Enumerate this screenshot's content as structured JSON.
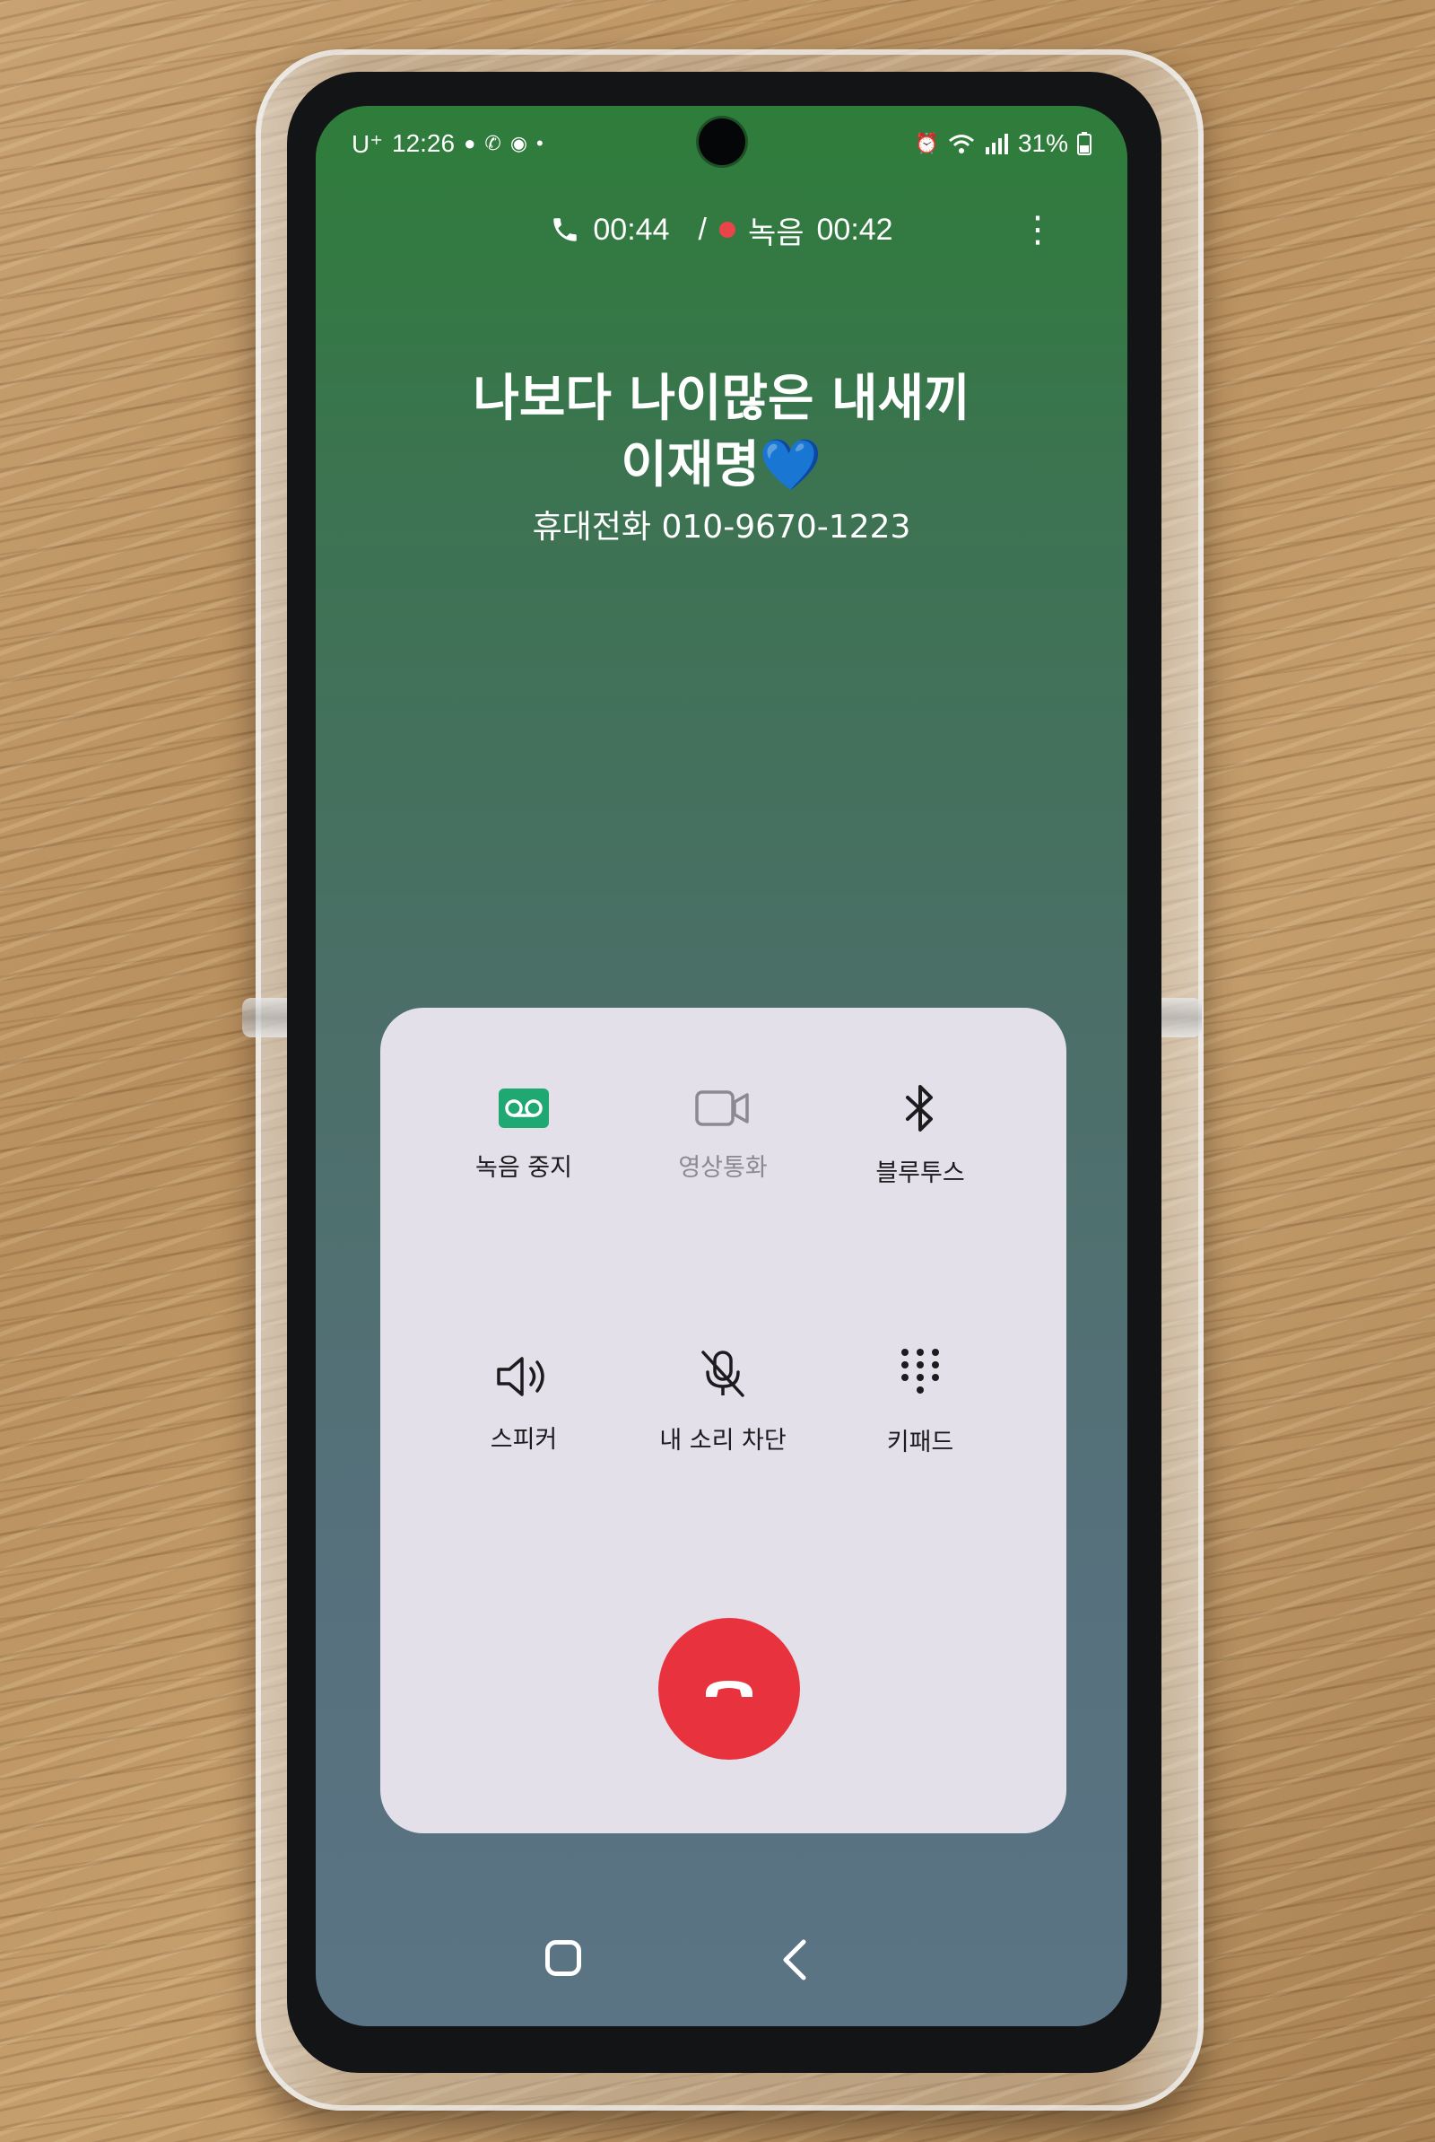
{
  "statusbar": {
    "carrier": "U⁺",
    "time": "12:26",
    "battery": "31%"
  },
  "call": {
    "duration": "00:44",
    "separator": "/",
    "recording_label": "녹음",
    "recording_time": "00:42",
    "more_icon": "⋮"
  },
  "contact": {
    "name_line1": "나보다 나이많은 내새끼",
    "name_line2": "이재명💙",
    "number": "휴대전화 010-9670-1223"
  },
  "controls": {
    "stop_recording": "녹음 중지",
    "video_call": "영상통화",
    "bluetooth": "블루투스",
    "speaker": "스피커",
    "mute": "내 소리 차단",
    "keypad": "키패드"
  },
  "colors": {
    "end_call": "#e8333e",
    "recording_accent": "#1fa872",
    "panel_bg": "#e4e0ea"
  },
  "icons": {
    "phone": "phone-icon",
    "voicemail": "voicemail-icon",
    "video": "video-camera-icon",
    "bluetooth": "bluetooth-icon",
    "speaker": "speaker-icon",
    "mic_off": "microphone-off-icon",
    "keypad": "keypad-icon",
    "end_call": "end-call-icon",
    "home": "home-icon",
    "back": "back-icon"
  }
}
